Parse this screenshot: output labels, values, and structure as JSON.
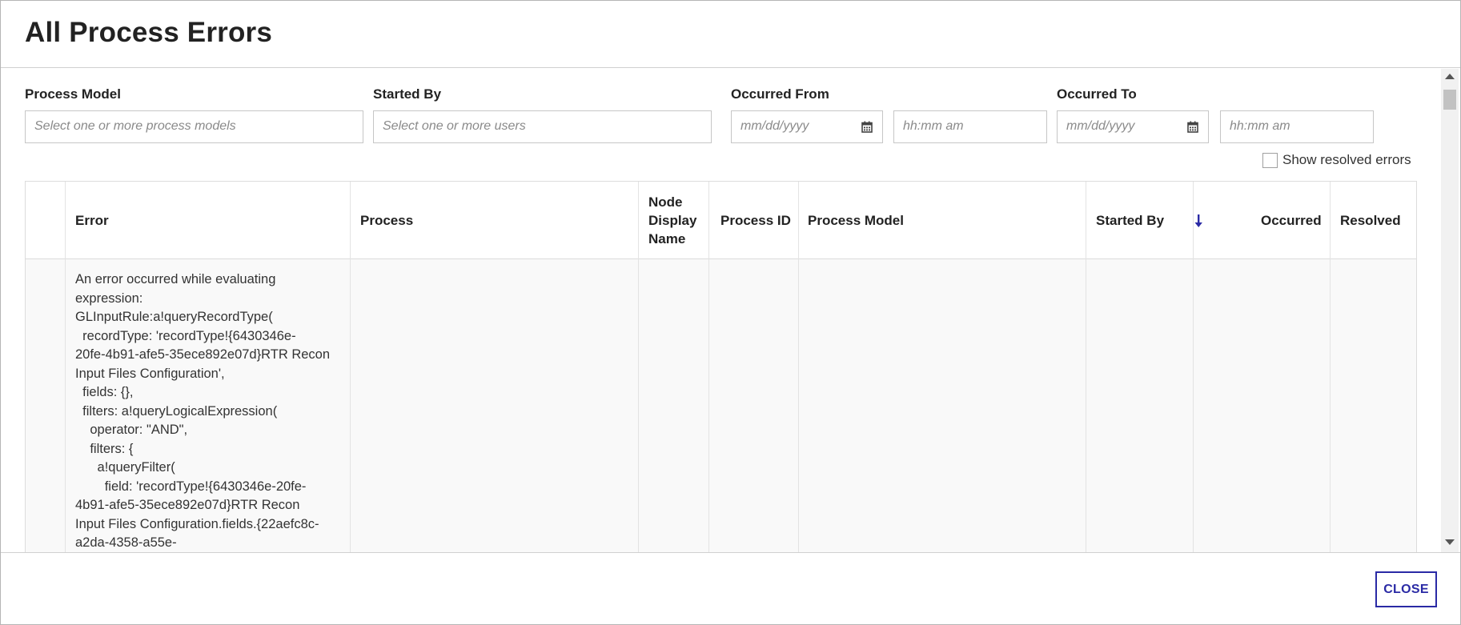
{
  "dialog": {
    "title": "All Process Errors",
    "close_label": "CLOSE"
  },
  "filters": {
    "process_model": {
      "label": "Process Model",
      "placeholder": "Select one or more process models"
    },
    "started_by": {
      "label": "Started By",
      "placeholder": "Select one or more users"
    },
    "occurred_from": {
      "label": "Occurred From",
      "date_placeholder": "mm/dd/yyyy",
      "time_placeholder": "hh:mm am"
    },
    "occurred_to": {
      "label": "Occurred To",
      "date_placeholder": "mm/dd/yyyy",
      "time_placeholder": "hh:mm am"
    },
    "show_resolved": {
      "label": "Show resolved errors",
      "checked": false
    }
  },
  "grid": {
    "columns": {
      "error": "Error",
      "process": "Process",
      "node_display_name": "Node\nDisplay\nName",
      "process_id": "Process ID",
      "process_model": "Process Model",
      "started_by": "Started By",
      "occurred": "Occurred",
      "resolved": "Resolved"
    },
    "sort_icon": "arrow-down-icon",
    "rows": [
      {
        "error": "An error occurred while evaluating\nexpression:\nGLInputRule:a!queryRecordType(\n  recordType: 'recordType!{6430346e-\n20fe-4b91-afe5-35ece892e07d}RTR Recon\nInput Files Configuration',\n  fields: {},\n  filters: a!queryLogicalExpression(\n    operator: \"AND\",\n    filters: {\n      a!queryFilter(\n        field: 'recordType!{6430346e-20fe-\n4b91-afe5-35ece892e07d}RTR Recon\nInput Files Configuration.fields.{22aefc8c-\na2da-4358-a55e-",
        "process": "",
        "node_display_name": "",
        "process_id": "",
        "process_model": "",
        "started_by": "",
        "occurred": "",
        "resolved": ""
      }
    ]
  },
  "colors": {
    "accent": "#2a2aa5",
    "border": "#c6c6c6",
    "placeholder": "#8a8a8a",
    "row_background": "#f9f9f9"
  }
}
